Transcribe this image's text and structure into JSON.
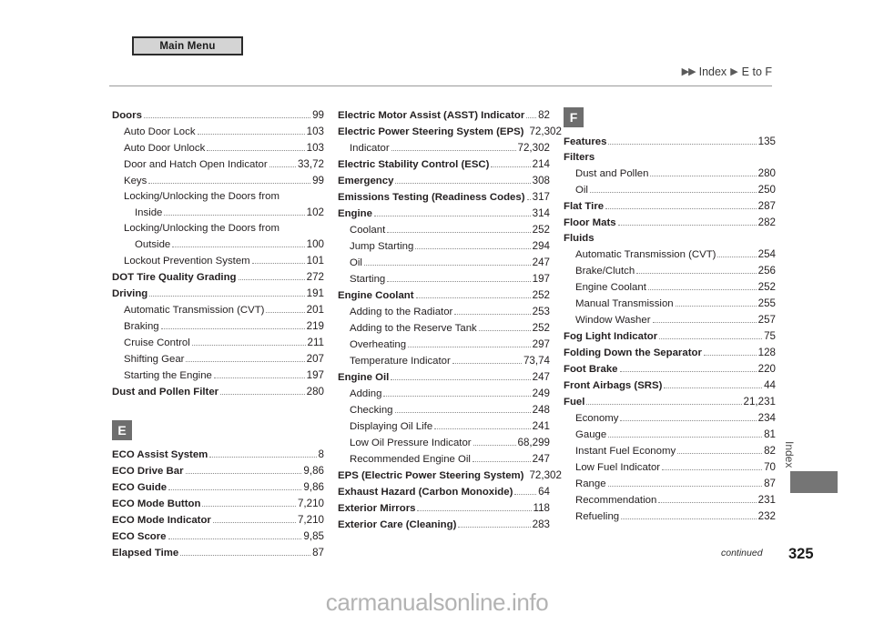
{
  "toolbar": {
    "main_menu_label": "Main Menu"
  },
  "breadcrumb": {
    "arrow_double": "▶▶",
    "arrow_single": "▶",
    "section": "Index",
    "range": "E to F"
  },
  "columns": [
    {
      "id": "column-1",
      "badge": null,
      "entries": [
        {
          "level": 0,
          "label": "Doors",
          "page": "99"
        },
        {
          "level": 1,
          "label": "Auto Door Lock",
          "page": "103"
        },
        {
          "level": 1,
          "label": "Auto Door Unlock",
          "page": "103"
        },
        {
          "level": 1,
          "label": "Door and Hatch Open Indicator",
          "page": "33,72"
        },
        {
          "level": 1,
          "label": "Keys",
          "page": "99"
        },
        {
          "level": 1,
          "label": "Locking/Unlocking the Doors from",
          "page": "",
          "noleader": true
        },
        {
          "level": 2,
          "label": "Inside",
          "page": "102"
        },
        {
          "level": 1,
          "label": "Locking/Unlocking the Doors from",
          "page": "",
          "noleader": true
        },
        {
          "level": 2,
          "label": "Outside",
          "page": "100"
        },
        {
          "level": 1,
          "label": "Lockout Prevention System",
          "page": "101"
        },
        {
          "level": 0,
          "label": "DOT Tire Quality Grading",
          "page": "272"
        },
        {
          "level": 0,
          "label": "Driving",
          "page": "191"
        },
        {
          "level": 1,
          "label": "Automatic Transmission (CVT)",
          "page": "201"
        },
        {
          "level": 1,
          "label": "Braking",
          "page": "219"
        },
        {
          "level": 1,
          "label": "Cruise Control",
          "page": "211"
        },
        {
          "level": 1,
          "label": "Shifting Gear",
          "page": "207"
        },
        {
          "level": 1,
          "label": "Starting the Engine",
          "page": "197"
        },
        {
          "level": 0,
          "label": "Dust and Pollen Filter",
          "page": "280"
        }
      ],
      "section2": {
        "badge": "E",
        "entries": [
          {
            "level": 0,
            "label": "ECO Assist System",
            "page": "8"
          },
          {
            "level": 0,
            "label": "ECO Drive Bar",
            "page": "9,86"
          },
          {
            "level": 0,
            "label": "ECO Guide",
            "page": "9,86"
          },
          {
            "level": 0,
            "label": "ECO Mode Button",
            "page": "7,210"
          },
          {
            "level": 0,
            "label": "ECO Mode Indicator",
            "page": "7,210"
          },
          {
            "level": 0,
            "label": "ECO Score",
            "page": "9,85"
          },
          {
            "level": 0,
            "label": "Elapsed Time",
            "page": "87"
          }
        ]
      }
    },
    {
      "id": "column-2",
      "badge": null,
      "entries": [
        {
          "level": 0,
          "label": "Electric Motor Assist (ASST) Indicator",
          "page": "82"
        },
        {
          "level": 0,
          "label": "Electric Power Steering System (EPS)",
          "page": "72,302",
          "noleader": true
        },
        {
          "level": 1,
          "label": "Indicator",
          "page": "72,302"
        },
        {
          "level": 0,
          "label": "Electric Stability Control (ESC)",
          "page": "214"
        },
        {
          "level": 0,
          "label": "Emergency",
          "page": "308"
        },
        {
          "level": 0,
          "label": "Emissions Testing (Readiness Codes)",
          "page": "317"
        },
        {
          "level": 0,
          "label": "Engine",
          "page": "314"
        },
        {
          "level": 1,
          "label": "Coolant",
          "page": "252"
        },
        {
          "level": 1,
          "label": "Jump Starting",
          "page": "294"
        },
        {
          "level": 1,
          "label": "Oil",
          "page": "247"
        },
        {
          "level": 1,
          "label": "Starting",
          "page": "197"
        },
        {
          "level": 0,
          "label": "Engine Coolant",
          "page": "252"
        },
        {
          "level": 1,
          "label": "Adding to the Radiator",
          "page": "253"
        },
        {
          "level": 1,
          "label": "Adding to the Reserve Tank",
          "page": "252"
        },
        {
          "level": 1,
          "label": "Overheating",
          "page": "297"
        },
        {
          "level": 1,
          "label": "Temperature Indicator",
          "page": "73,74"
        },
        {
          "level": 0,
          "label": "Engine Oil",
          "page": "247"
        },
        {
          "level": 1,
          "label": "Adding",
          "page": "249"
        },
        {
          "level": 1,
          "label": "Checking",
          "page": "248"
        },
        {
          "level": 1,
          "label": "Displaying Oil Life",
          "page": "241"
        },
        {
          "level": 1,
          "label": "Low Oil Pressure Indicator",
          "page": "68,299"
        },
        {
          "level": 1,
          "label": "Recommended Engine Oil",
          "page": "247"
        },
        {
          "level": 0,
          "label": "EPS (Electric Power Steering System)",
          "page": "72,302",
          "noleader": true
        },
        {
          "level": 0,
          "label": "Exhaust Hazard (Carbon Monoxide)",
          "page": "64"
        },
        {
          "level": 0,
          "label": "Exterior Mirrors",
          "page": "118"
        },
        {
          "level": 0,
          "label": "Exterior Care (Cleaning)",
          "page": "283"
        }
      ]
    },
    {
      "id": "column-3",
      "badge": "F",
      "entries": [
        {
          "level": 0,
          "label": "Features",
          "page": "135"
        },
        {
          "level": 0,
          "label": "Filters",
          "page": "",
          "nopage": true
        },
        {
          "level": 1,
          "label": "Dust and Pollen",
          "page": "280"
        },
        {
          "level": 1,
          "label": "Oil",
          "page": "250"
        },
        {
          "level": 0,
          "label": "Flat Tire",
          "page": "287"
        },
        {
          "level": 0,
          "label": "Floor Mats",
          "page": "282"
        },
        {
          "level": 0,
          "label": "Fluids",
          "page": "",
          "nopage": true
        },
        {
          "level": 1,
          "label": "Automatic Transmission (CVT)",
          "page": "254"
        },
        {
          "level": 1,
          "label": "Brake/Clutch",
          "page": "256"
        },
        {
          "level": 1,
          "label": "Engine Coolant",
          "page": "252"
        },
        {
          "level": 1,
          "label": "Manual Transmission",
          "page": "255"
        },
        {
          "level": 1,
          "label": "Window Washer",
          "page": "257"
        },
        {
          "level": 0,
          "label": "Fog Light Indicator",
          "page": "75"
        },
        {
          "level": 0,
          "label": "Folding Down the Separator",
          "page": "128"
        },
        {
          "level": 0,
          "label": "Foot Brake",
          "page": "220"
        },
        {
          "level": 0,
          "label": "Front Airbags (SRS)",
          "page": "44"
        },
        {
          "level": 0,
          "label": "Fuel",
          "page": "21,231"
        },
        {
          "level": 1,
          "label": "Economy",
          "page": "234"
        },
        {
          "level": 1,
          "label": "Gauge",
          "page": "81"
        },
        {
          "level": 1,
          "label": "Instant Fuel Economy",
          "page": "82"
        },
        {
          "level": 1,
          "label": "Low Fuel Indicator",
          "page": "70"
        },
        {
          "level": 1,
          "label": "Range",
          "page": "87"
        },
        {
          "level": 1,
          "label": "Recommendation",
          "page": "231"
        },
        {
          "level": 1,
          "label": "Refueling",
          "page": "232"
        }
      ]
    }
  ],
  "side_tab": {
    "label": "Index"
  },
  "footer": {
    "continued": "continued",
    "page_number": "325",
    "watermark": "carmanualsonline.info"
  },
  "colors": {
    "badge_bg": "#6e6e6e",
    "tab_block": "#757575",
    "button_bg": "#d4d4d4",
    "rule": "#9a9a9a"
  }
}
